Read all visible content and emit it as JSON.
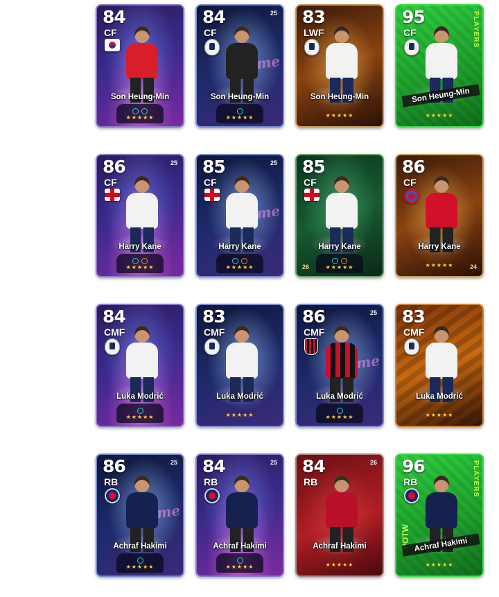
{
  "cards": [
    {
      "rating": "84",
      "position": "CF",
      "name": "Son Heung-Min",
      "badge": "kor",
      "kit": "kit-red",
      "theme": "t-showtime",
      "skills": [
        "teal",
        "teal"
      ],
      "stars": "★★★★★"
    },
    {
      "rating": "84",
      "position": "CF",
      "name": "Son Heung-Min",
      "badge": "crest",
      "kit": "kit-black",
      "theme": "t-blue",
      "skills": [
        "teal"
      ],
      "stars": "★★★★★",
      "corner": "25",
      "deco": "me"
    },
    {
      "rating": "83",
      "position": "LWF",
      "name": "Son Heung-Min",
      "badge": "crest",
      "kit": "kit-white",
      "theme": "t-gold",
      "skills": [],
      "stars": "★★★★★"
    },
    {
      "rating": "95",
      "position": "CF",
      "name": "Son Heung-Min",
      "badge": "crest",
      "kit": "kit-white",
      "theme": "t-green",
      "skills": [],
      "stars": "★★★★★",
      "banner": true,
      "side": "PLAYERS"
    },
    {
      "rating": "86",
      "position": "CF",
      "name": "Harry Kane",
      "badge": "eng",
      "kit": "kit-white",
      "theme": "t-showtime",
      "skills": [
        "teal",
        "orange"
      ],
      "stars": "★★★★★",
      "corner": "25"
    },
    {
      "rating": "85",
      "position": "CF",
      "name": "Harry Kane",
      "badge": "eng",
      "kit": "kit-white",
      "theme": "t-blue",
      "skills": [
        "teal",
        "orange"
      ],
      "stars": "★★★★★",
      "corner": "25",
      "deco": "me"
    },
    {
      "rating": "85",
      "position": "CF",
      "name": "Harry Kane",
      "badge": "eng",
      "kit": "kit-white",
      "theme": "t-darkgreen",
      "skills": [
        "teal",
        "orange"
      ],
      "stars": "★★★★★",
      "corner_bl": "26"
    },
    {
      "rating": "86",
      "position": "CF",
      "name": "Harry Kane",
      "badge": "bayern",
      "kit": "kit-bayern",
      "theme": "t-gold",
      "skills": [],
      "stars": "★★★★★",
      "corner_br": "24"
    },
    {
      "rating": "84",
      "position": "CMF",
      "name": "Luka Modrić",
      "badge": "crest",
      "kit": "kit-white",
      "theme": "t-showtime",
      "skills": [
        "teal"
      ],
      "stars": "★★★★★"
    },
    {
      "rating": "83",
      "position": "CMF",
      "name": "Luka Modrić",
      "badge": "crest",
      "kit": "kit-white",
      "theme": "t-blue",
      "skills": [],
      "stars": "★★★★★"
    },
    {
      "rating": "86",
      "position": "CMF",
      "name": "Luka Modrić",
      "badge": "milan",
      "kit": "kit-milan",
      "theme": "t-blue",
      "skills": [
        "teal"
      ],
      "stars": "★★★★★",
      "corner": "25",
      "deco": "me"
    },
    {
      "rating": "83",
      "position": "CMF",
      "name": "Luka Modrić",
      "badge": "crest",
      "kit": "kit-white",
      "theme": "t-orange",
      "skills": [],
      "stars": "★★★★★"
    },
    {
      "rating": "86",
      "position": "RB",
      "name": "Achraf Hakimi",
      "badge": "psg",
      "kit": "kit-navy",
      "theme": "t-blue",
      "skills": [
        "teal"
      ],
      "stars": "★★★★★",
      "corner": "25",
      "deco": "me"
    },
    {
      "rating": "84",
      "position": "RB",
      "name": "Achraf Hakimi",
      "badge": "psg",
      "kit": "kit-navy",
      "theme": "t-showtime",
      "skills": [
        "teal"
      ],
      "stars": "★★★★★",
      "corner": "25"
    },
    {
      "rating": "84",
      "position": "RB",
      "name": "Achraf Hakimi",
      "badge": "none",
      "kit": "kit-morocco",
      "theme": "t-red",
      "skills": [],
      "stars": "★★★★★",
      "corner": "26"
    },
    {
      "rating": "96",
      "position": "RB",
      "name": "Achraf Hakimi",
      "badge": "psg",
      "kit": "kit-navy",
      "theme": "t-green",
      "skills": [],
      "stars": "★★★★★",
      "banner": true,
      "potw": "POTW",
      "side": "PLAYERS"
    }
  ]
}
